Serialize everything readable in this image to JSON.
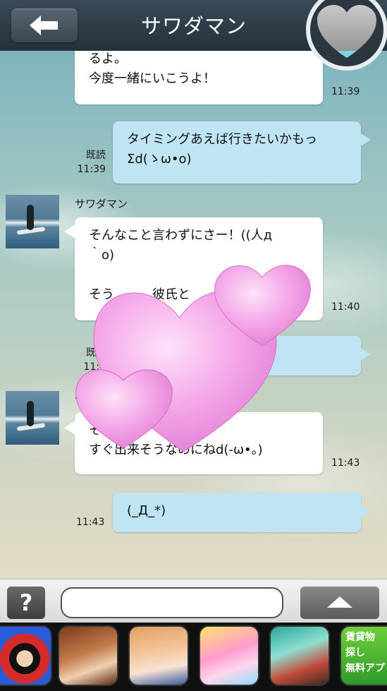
{
  "header": {
    "title": "サワダマン",
    "back_icon": "arrow-left-icon",
    "heart_meter_icon": "heart-icon",
    "heart_meter_level": 0.15
  },
  "messages": [
    {
      "direction": "in",
      "text": "るよ。\n今度一緒にいこうよ！",
      "time": "11:39"
    },
    {
      "direction": "out",
      "text": "タイミングあえば行きたいかもっ\nΣd(ゝω•o)",
      "read": "既読",
      "time": "11:39"
    },
    {
      "direction": "in",
      "sender": "サワダマン",
      "text": "そんなこと言わずにさー！((人д\n｀o)\n\nそう　　　彼氏と",
      "time": "11:40"
    },
    {
      "direction": "out",
      "text": "",
      "read": "既読",
      "time": "11:4"
    },
    {
      "direction": "in",
      "sender": "サ",
      "text": "そ　　　？\nすぐ出来そうなのにねd(-ω•。)",
      "time": "11:43"
    },
    {
      "direction": "out",
      "text": "(_Д_*)",
      "time": "11:43"
    }
  ],
  "input": {
    "help_label": "?",
    "placeholder": "",
    "send_icon": "triangle-up-icon"
  },
  "ads": [
    {
      "name": "mouse-character",
      "label": ""
    },
    {
      "name": "anime-boy",
      "label": ""
    },
    {
      "name": "anime-girl",
      "label": ""
    },
    {
      "name": "cute-fairies",
      "label": ""
    },
    {
      "name": "fantasy-warrior",
      "label": ""
    },
    {
      "name": "real-estate",
      "label": "賃貸物\n探し\n無料アプ"
    }
  ],
  "colors": {
    "header_bg": "#23313b",
    "outgoing_bubble": "#bfe5f5",
    "incoming_bubble": "#ffffff",
    "heart_pink": "#f4a6e8"
  }
}
